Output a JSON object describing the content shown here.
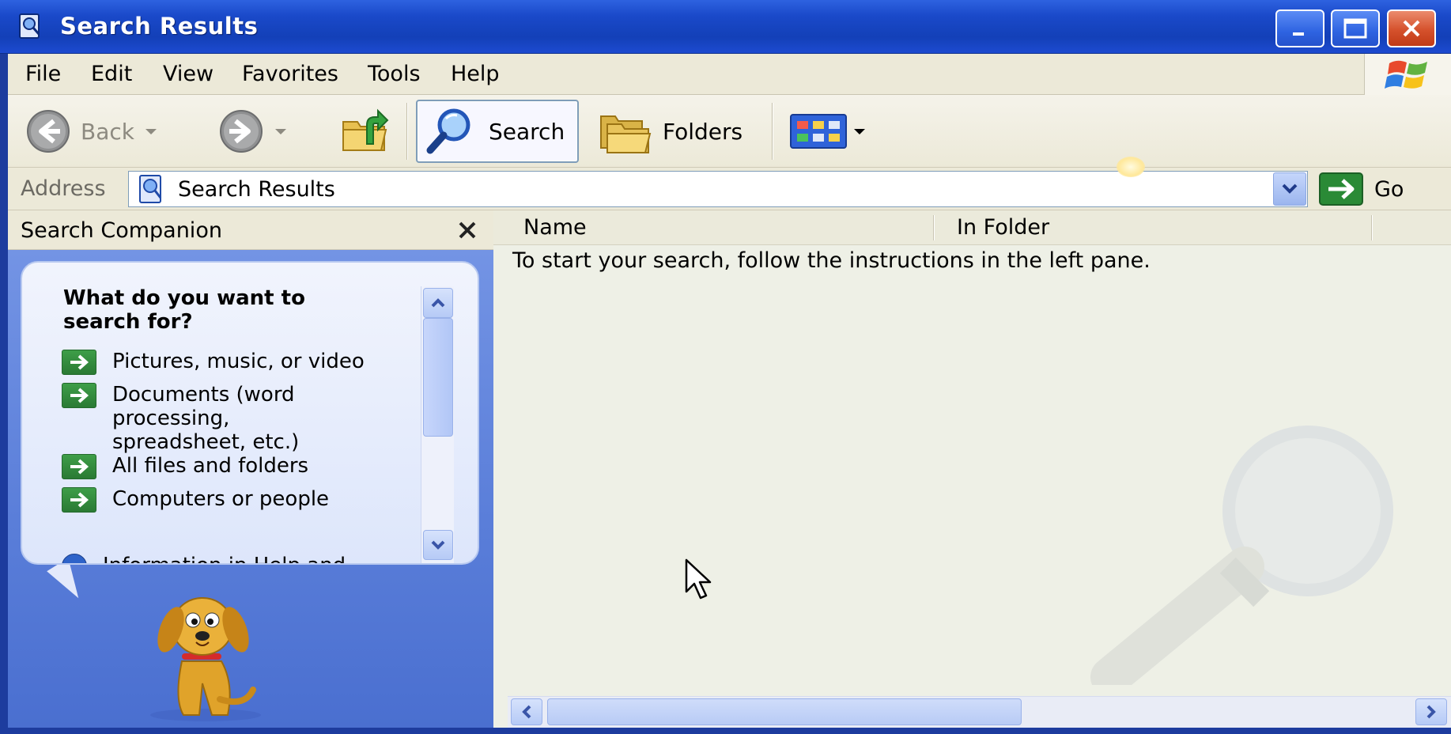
{
  "window": {
    "title": "Search Results",
    "controls": {
      "minimize": "minimize",
      "maximize": "maximize",
      "close": "close"
    }
  },
  "menu": {
    "items": [
      {
        "label": "File"
      },
      {
        "label": "Edit"
      },
      {
        "label": "View"
      },
      {
        "label": "Favorites"
      },
      {
        "label": "Tools"
      },
      {
        "label": "Help"
      }
    ]
  },
  "toolbar": {
    "back_label": "Back",
    "search_label": "Search",
    "folders_label": "Folders"
  },
  "address": {
    "label": "Address",
    "value": "Search Results",
    "go_label": "Go"
  },
  "search_companion": {
    "title": "Search Companion",
    "question": "What do you want to search for?",
    "options": [
      {
        "label": "Pictures, music, or video"
      },
      {
        "label": "Documents (word processing, spreadsheet, etc.)"
      },
      {
        "label": "All files and folders"
      },
      {
        "label": "Computers or people"
      },
      {
        "label": "Information in Help and"
      }
    ]
  },
  "results": {
    "columns": [
      {
        "label": "Name"
      },
      {
        "label": "In Folder"
      }
    ],
    "hint": "To start your search, follow the instructions in the left pane."
  },
  "colors": {
    "titlebar": "#1a49c9",
    "chrome": "#ece9d8",
    "left_pane": "#5a7ed9",
    "go_green": "#2a7a34"
  }
}
